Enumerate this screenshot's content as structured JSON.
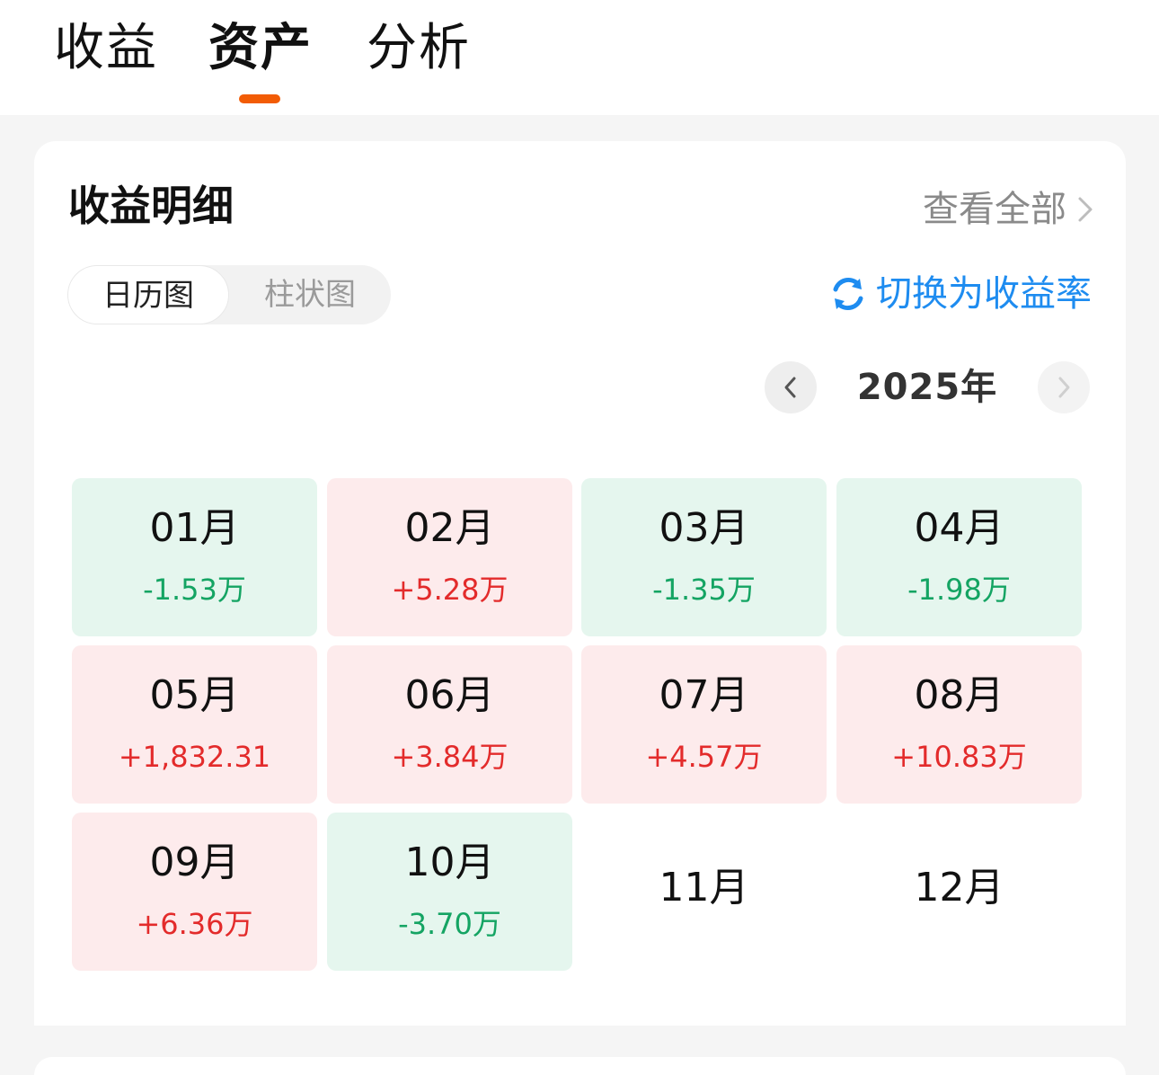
{
  "tabs": [
    {
      "label": "收益",
      "active": false
    },
    {
      "label": "资产",
      "active": true
    },
    {
      "label": "分析",
      "active": false
    }
  ],
  "accent_color": "#f25c05",
  "card": {
    "title": "收益明细",
    "view_all": "查看全部",
    "segments": [
      "日历图",
      "柱状图"
    ],
    "switch_rate": "切换为收益率",
    "year": "2025年"
  },
  "months": [
    {
      "label": "01月",
      "value": "-1.53万",
      "sign": "neg"
    },
    {
      "label": "02月",
      "value": "+5.28万",
      "sign": "pos"
    },
    {
      "label": "03月",
      "value": "-1.35万",
      "sign": "neg"
    },
    {
      "label": "04月",
      "value": "-1.98万",
      "sign": "neg"
    },
    {
      "label": "05月",
      "value": "+1,832.31",
      "sign": "pos"
    },
    {
      "label": "06月",
      "value": "+3.84万",
      "sign": "pos"
    },
    {
      "label": "07月",
      "value": "+4.57万",
      "sign": "pos"
    },
    {
      "label": "08月",
      "value": "+10.83万",
      "sign": "pos"
    },
    {
      "label": "09月",
      "value": "+6.36万",
      "sign": "pos"
    },
    {
      "label": "10月",
      "value": "-3.70万",
      "sign": "neg"
    },
    {
      "label": "11月",
      "value": "",
      "sign": "empty"
    },
    {
      "label": "12月",
      "value": "",
      "sign": "empty"
    }
  ],
  "colors": {
    "positive": "#e32b2b",
    "negative": "#14a463",
    "link": "#1e8cf0"
  }
}
